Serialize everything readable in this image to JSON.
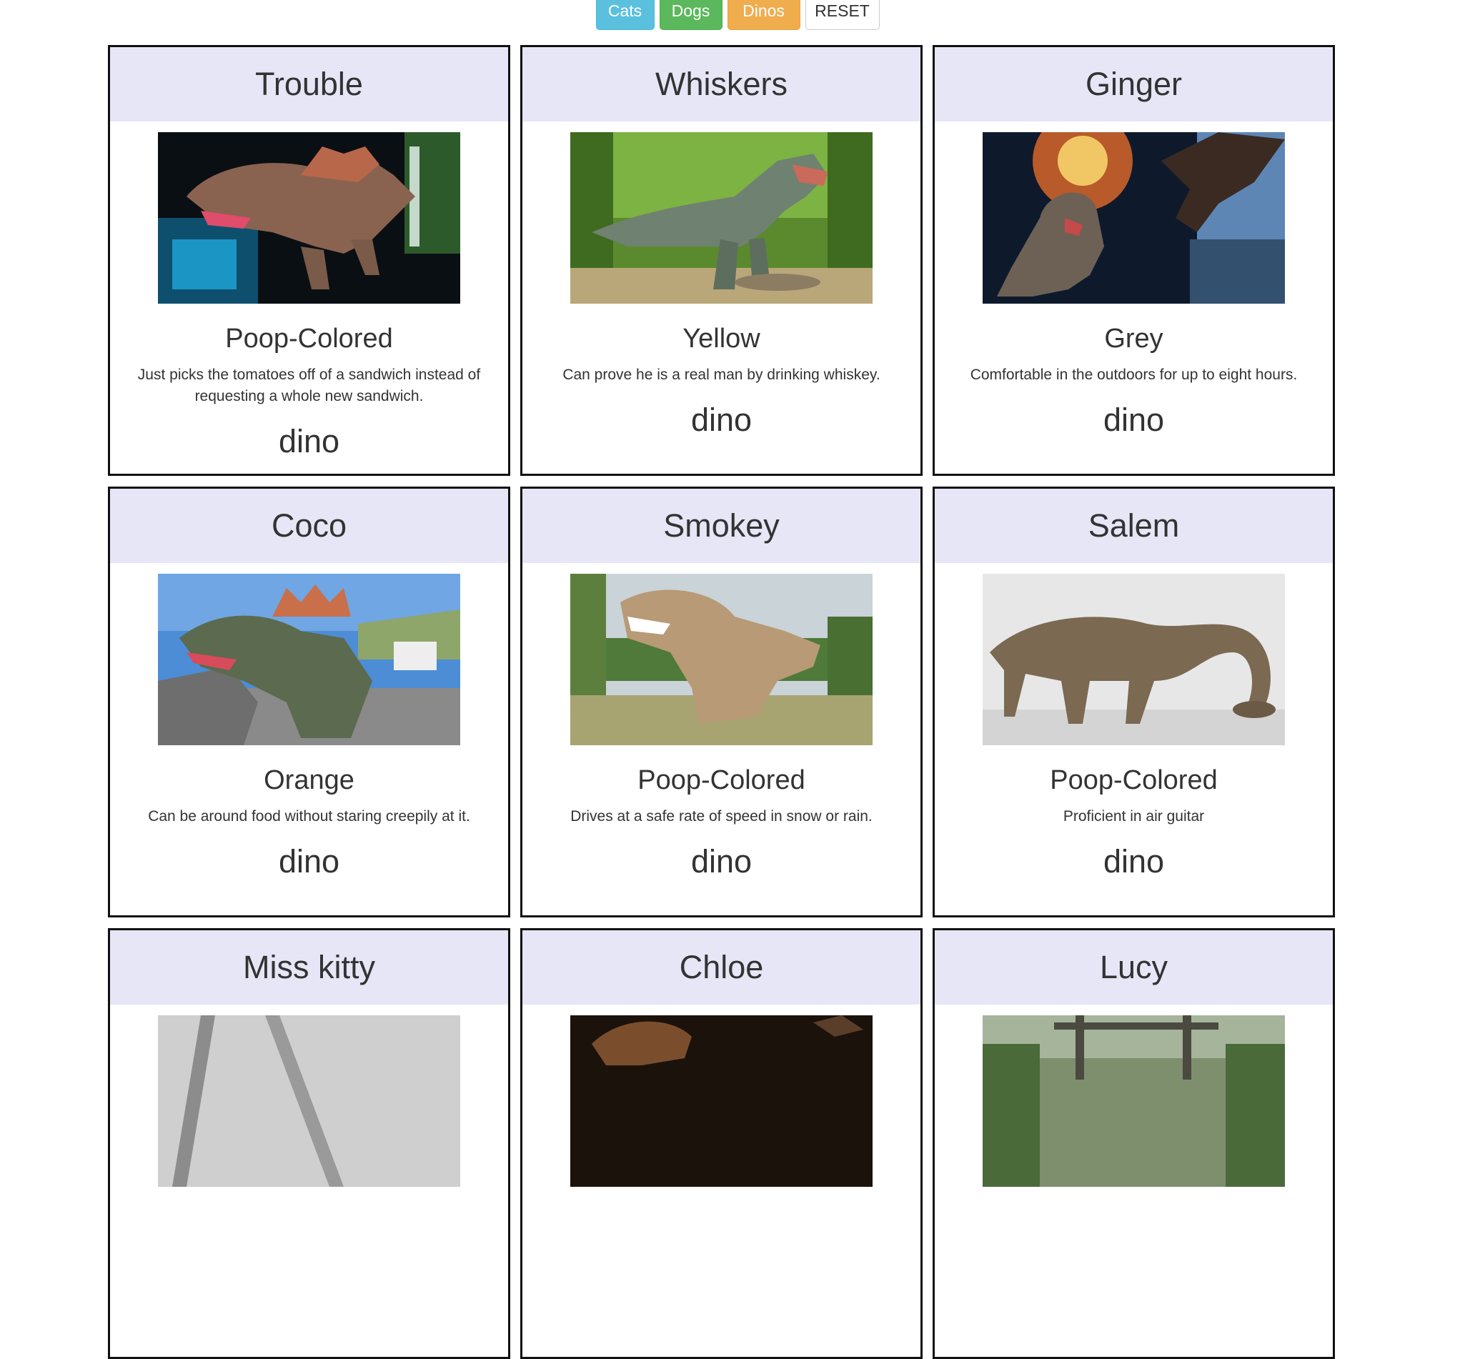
{
  "filters": {
    "cats": "Cats",
    "dogs": "Dogs",
    "dinos": "Dinos",
    "reset": "RESET"
  },
  "colors": {
    "cats": "#5bc0de",
    "dogs": "#5cb85c",
    "dinos": "#f0ad4e",
    "card_header": "#e6e6f7"
  },
  "pets": [
    {
      "name": "Trouble",
      "color": "Poop-Colored",
      "desc": "Just picks the tomatoes off of a sandwich instead of requesting a whole new sandwich.",
      "type": "dino"
    },
    {
      "name": "Whiskers",
      "color": "Yellow",
      "desc": "Can prove he is a real man by drinking whiskey.",
      "type": "dino"
    },
    {
      "name": "Ginger",
      "color": "Grey",
      "desc": "Comfortable in the outdoors for up to eight hours.",
      "type": "dino"
    },
    {
      "name": "Coco",
      "color": "Orange",
      "desc": "Can be around food without staring creepily at it.",
      "type": "dino"
    },
    {
      "name": "Smokey",
      "color": "Poop-Colored",
      "desc": "Drives at a safe rate of speed in snow or rain.",
      "type": "dino"
    },
    {
      "name": "Salem",
      "color": "Poop-Colored",
      "desc": "Proficient in air guitar",
      "type": "dino"
    },
    {
      "name": "Miss kitty",
      "color": "",
      "desc": "",
      "type": ""
    },
    {
      "name": "Chloe",
      "color": "",
      "desc": "",
      "type": ""
    },
    {
      "name": "Lucy",
      "color": "",
      "desc": "",
      "type": ""
    }
  ]
}
